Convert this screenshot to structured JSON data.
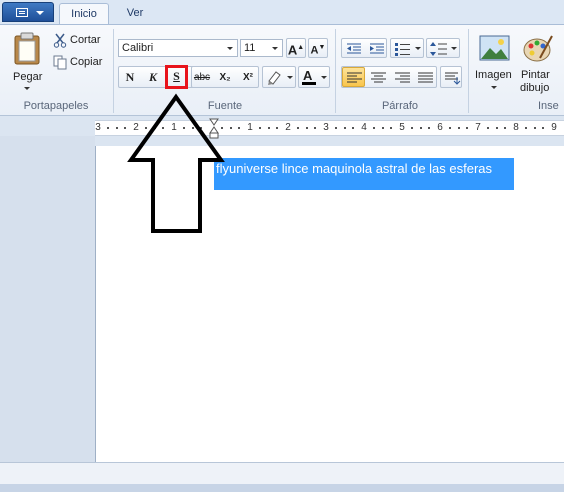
{
  "tabs": {
    "home": "Inicio",
    "view": "Ver"
  },
  "clipboard": {
    "paste": "Pegar",
    "cut": "Cortar",
    "copy": "Copiar",
    "group": "Portapapeles"
  },
  "font": {
    "family": "Calibri",
    "size": "11",
    "bold": "N",
    "italic": "K",
    "underline": "S",
    "strike": "abc",
    "subscript": "X₂",
    "superscript": "X²",
    "group": "Fuente"
  },
  "paragraph": {
    "group": "Párrafo"
  },
  "insert": {
    "image_line1": "Imagen",
    "paint_line1": "Pintar",
    "paint_line2": "dibujo",
    "group_partial": "Inse"
  },
  "ruler": {
    "labels": [
      "3",
      "2",
      "1",
      "1",
      "2",
      "3",
      "4",
      "5",
      "6",
      "7",
      "8",
      "9"
    ]
  },
  "document": {
    "selected_text": "flyuniverse lince maquinola astral de las esferas"
  },
  "colors": {
    "selection": "#3399ff",
    "highlight_box": "#e8141c",
    "accent": "#2b579a"
  }
}
